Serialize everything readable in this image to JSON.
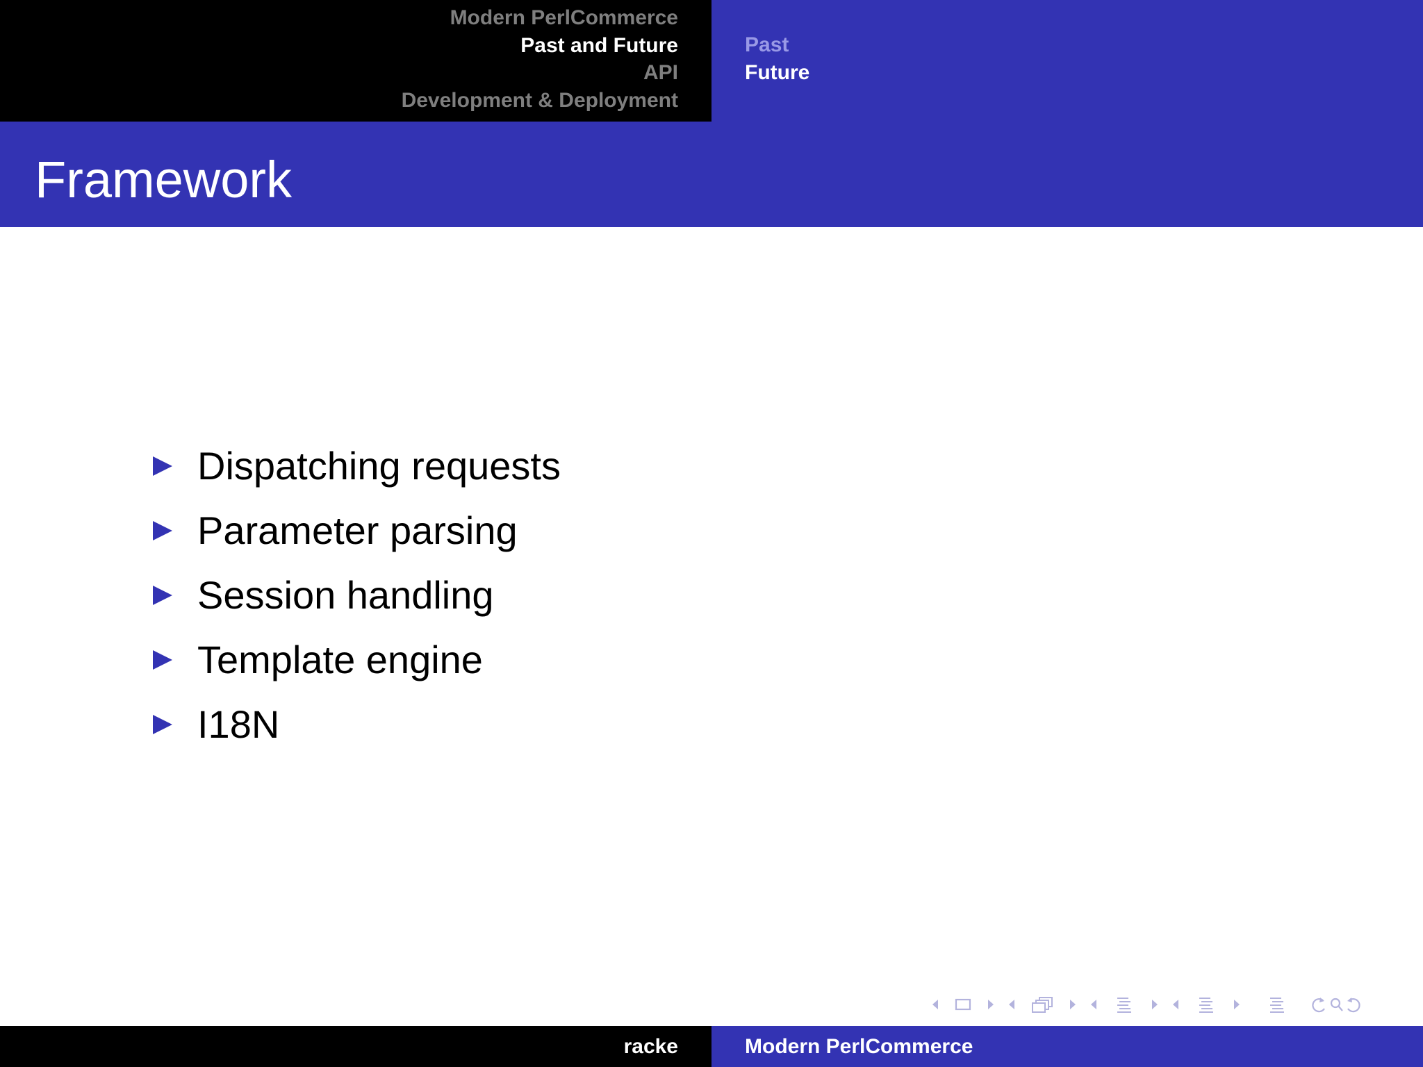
{
  "header": {
    "sections": [
      {
        "label": "Modern PerlCommerce",
        "active": false
      },
      {
        "label": "Past and Future",
        "active": true
      },
      {
        "label": "API",
        "active": false
      },
      {
        "label": "Development & Deployment",
        "active": false
      }
    ],
    "subsections": [
      {
        "label": "Past",
        "active": false
      },
      {
        "label": "Future",
        "active": true
      }
    ]
  },
  "frame": {
    "title": "Framework",
    "bullets": [
      "Dispatching requests",
      "Parameter parsing",
      "Session handling",
      "Template engine",
      "I18N"
    ]
  },
  "navigation": {
    "icons": [
      "slide-navigation-icon",
      "frame-navigation-icon",
      "subsection-navigation-icon",
      "section-navigation-icon",
      "presentation-navigation-icon",
      "back-search-forward-icon"
    ]
  },
  "footer": {
    "author": "racke",
    "title": "Modern PerlCommerce"
  },
  "colors": {
    "structure": "#3333b3",
    "header_dark": "#000000",
    "inactive_section": "#7f7f7f",
    "inactive_subsection": "#9999e6",
    "nav_symbol": "#b3b3dd"
  }
}
